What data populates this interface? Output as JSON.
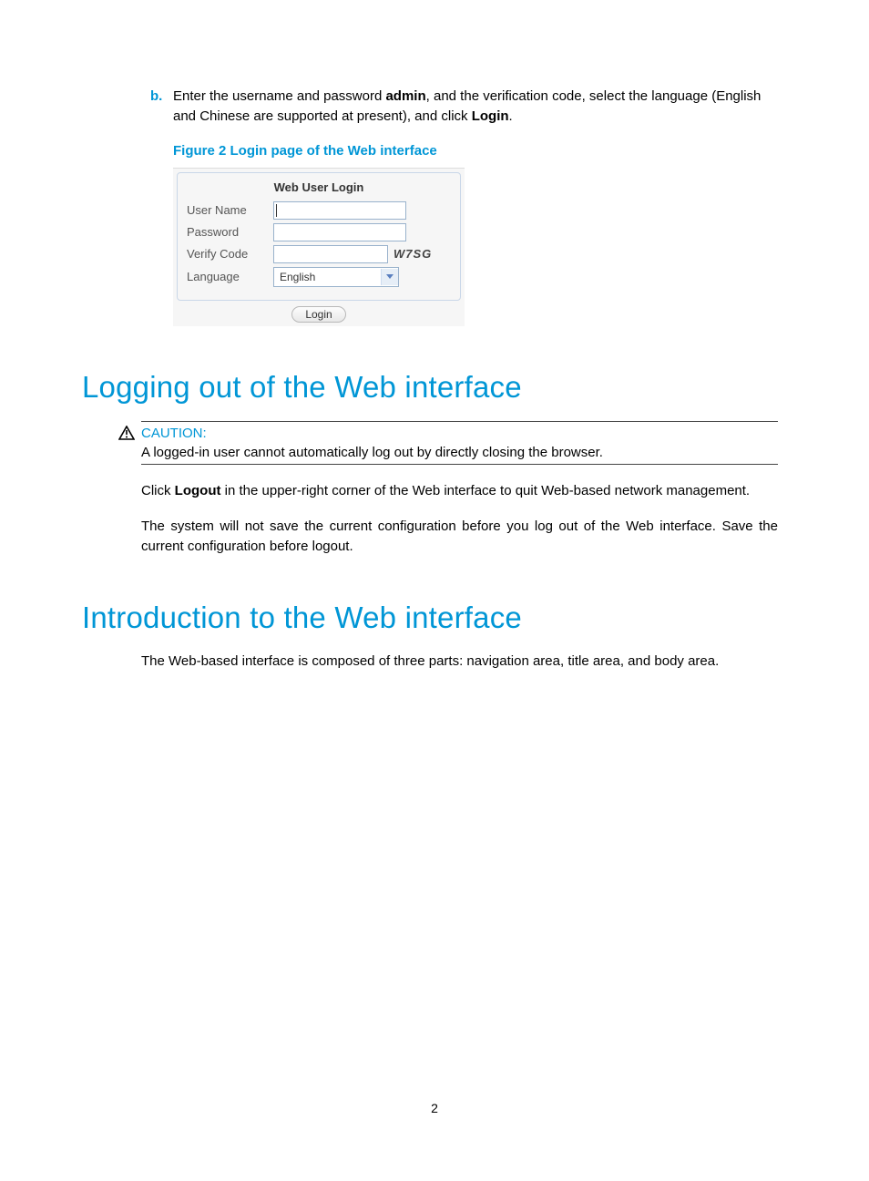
{
  "step": {
    "marker": "b.",
    "text_before": "Enter the username and password ",
    "bold1": "admin",
    "text_mid": ", and the verification code, select the language (English and Chinese are supported at present), and click ",
    "bold2": "Login",
    "text_after": "."
  },
  "figure_caption": "Figure 2 Login page of the Web interface",
  "login": {
    "title": "Web User Login",
    "rows": {
      "username_label": "User Name",
      "password_label": "Password",
      "verify_label": "Verify Code",
      "verify_code": "W7SG",
      "language_label": "Language",
      "language_value": "English"
    },
    "button": "Login"
  },
  "section1_heading": "Logging out of the Web interface",
  "caution": {
    "label": "CAUTION:",
    "text": "A logged-in user cannot automatically log out by directly closing the browser."
  },
  "para1": {
    "before": "Click ",
    "bold": "Logout",
    "after": " in the upper-right corner of the Web interface to quit Web-based network management."
  },
  "para2": "The system will not save the current configuration before you log out of the Web interface. Save the current configuration before logout.",
  "section2_heading": "Introduction to the Web interface",
  "para3": "The Web-based interface is composed of three parts: navigation area, title area, and body area.",
  "page_number": "2"
}
